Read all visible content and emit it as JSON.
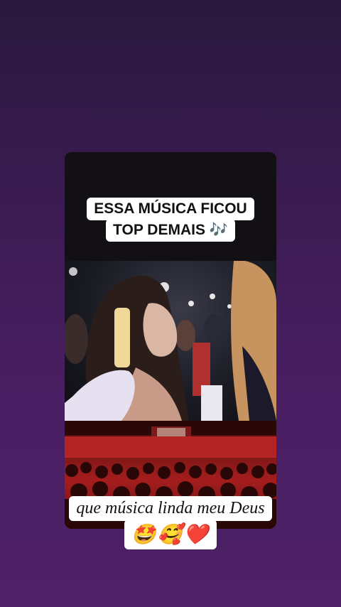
{
  "story": {
    "caption_top_line1": "ESSA MÚSICA FICOU",
    "caption_top_line2": "TOP DEMAIS 🎶",
    "caption_bottom_line1": "que música linda meu Deus",
    "caption_bottom_line2": "🤩🥰❤️"
  },
  "colors": {
    "background_top": "#2a1a3e",
    "background_bottom": "#4e2066",
    "caption_bg": "#ffffff",
    "caption_text": "#111111",
    "crowd_red": "#a51d1d"
  }
}
